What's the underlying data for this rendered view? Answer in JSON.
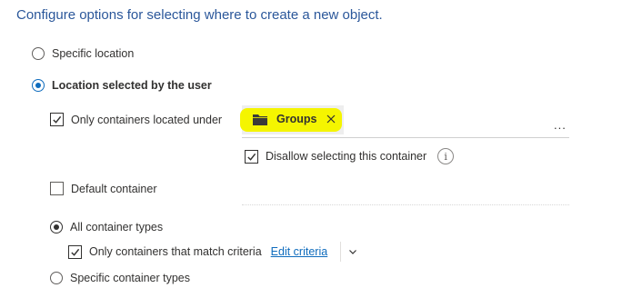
{
  "heading": "Configure options for selecting where to create a new object.",
  "location": {
    "specific_label": "Specific location",
    "user_selected_label": "Location selected by the user"
  },
  "containers_under": {
    "label": "Only containers located under",
    "chip_label": "Groups",
    "chip_icon": "folder-icon",
    "more": "..."
  },
  "disallow": {
    "label": "Disallow selecting this container",
    "info": "i"
  },
  "default_container": {
    "label": "Default container"
  },
  "container_types": {
    "all_label": "All container types",
    "match_label": "Only containers that match criteria",
    "edit_link": "Edit criteria",
    "specific_label": "Specific container types"
  },
  "colors": {
    "accent": "#0f6cbd",
    "heading": "#2b579a",
    "highlight": "#f5f500"
  }
}
